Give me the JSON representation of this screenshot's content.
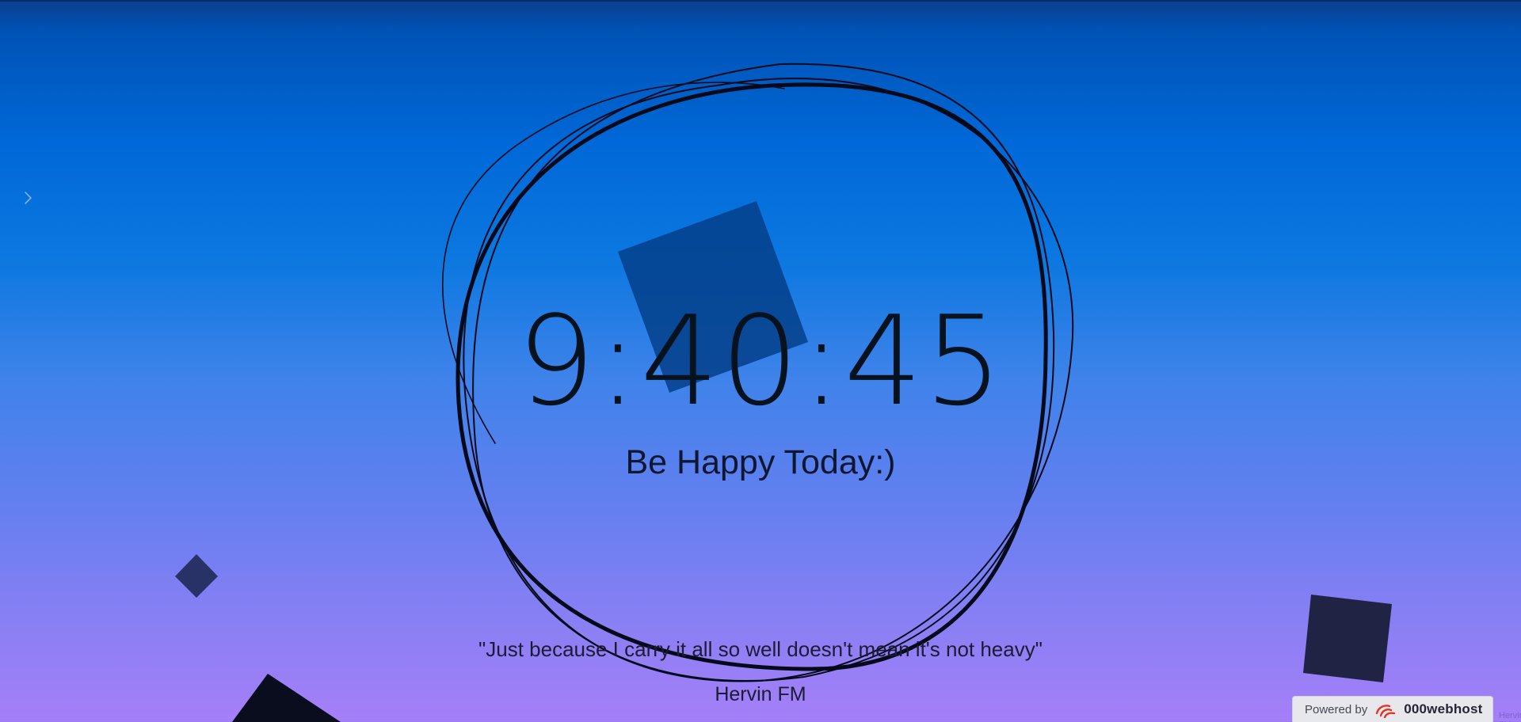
{
  "clock": {
    "time": "9:40:45"
  },
  "greeting": {
    "text": "Be Happy Today:)"
  },
  "quote": {
    "text": "\"Just because I carry it all so well doesn't mean it's not heavy\"",
    "author": "Hervin FM"
  },
  "badge": {
    "powered_label": "Powered by",
    "brand": "000webhost"
  },
  "watermark": {
    "text": "Hervin FM"
  },
  "icons": {
    "sidebar_toggle": "chevron-right-icon",
    "brand_logo": "webhost-logo-icon"
  },
  "colors": {
    "background_top": "#0053b5",
    "background_bottom": "#a57ff8",
    "scribble": "#050a1a",
    "shape_square": "#1f2448",
    "brand_red": "#e0362a"
  }
}
